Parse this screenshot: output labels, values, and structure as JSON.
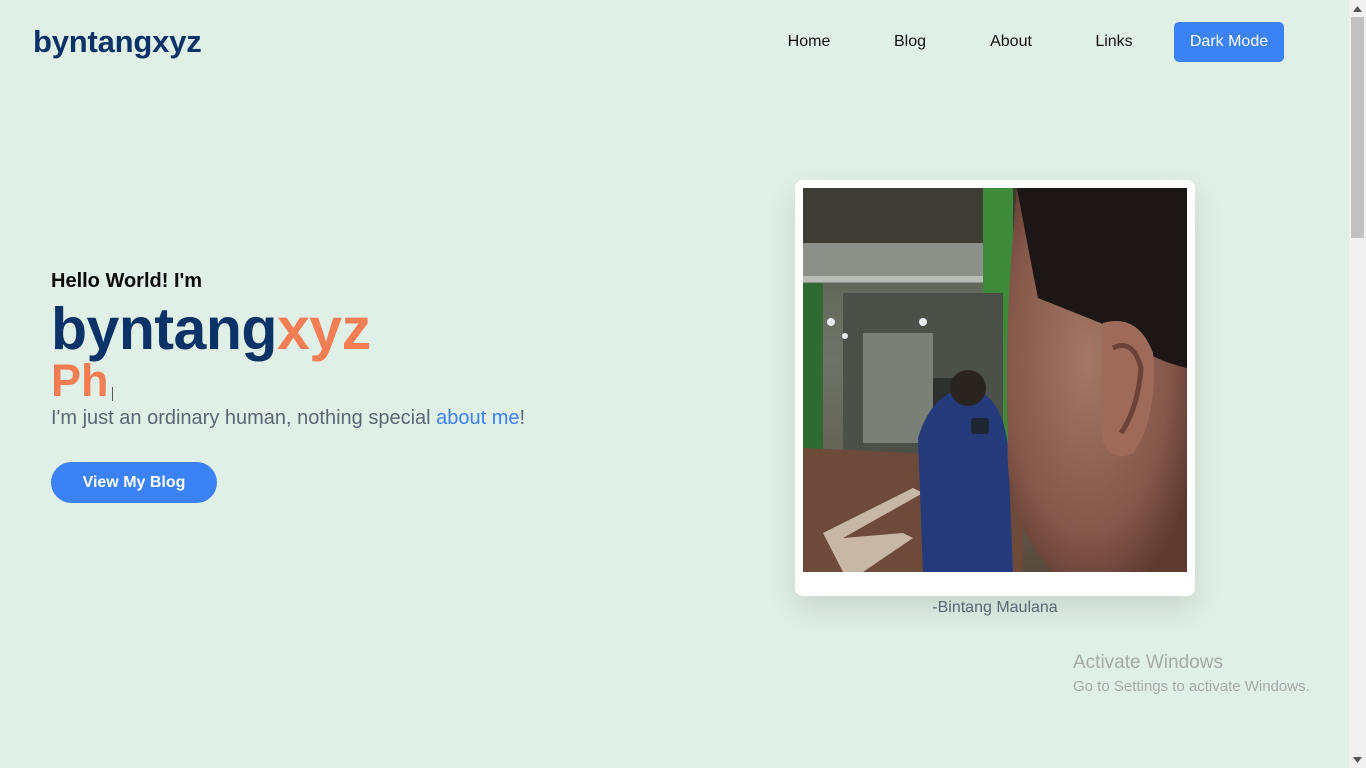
{
  "header": {
    "logo": "byntangxyz",
    "nav": [
      "Home",
      "Blog",
      "About",
      "Links"
    ],
    "dark_mode_label": "Dark Mode"
  },
  "hero": {
    "greeting": "Hello World! I'm",
    "name_part1": "byntang",
    "name_part2": "xyz",
    "typed_text": "Ph",
    "tagline_prefix": "I'm just an ordinary human, nothing special ",
    "tagline_link": "about me",
    "tagline_suffix": "!",
    "cta_label": "View My Blog"
  },
  "photo": {
    "caption": "-Bintang Maulana"
  },
  "os_overlay": {
    "title": "Activate Windows",
    "subtitle": "Go to Settings to activate Windows."
  },
  "colors": {
    "background": "#e1f0e7",
    "brand_navy": "#0b3368",
    "accent_orange": "#f47e53",
    "button_blue": "#3b82f6"
  }
}
